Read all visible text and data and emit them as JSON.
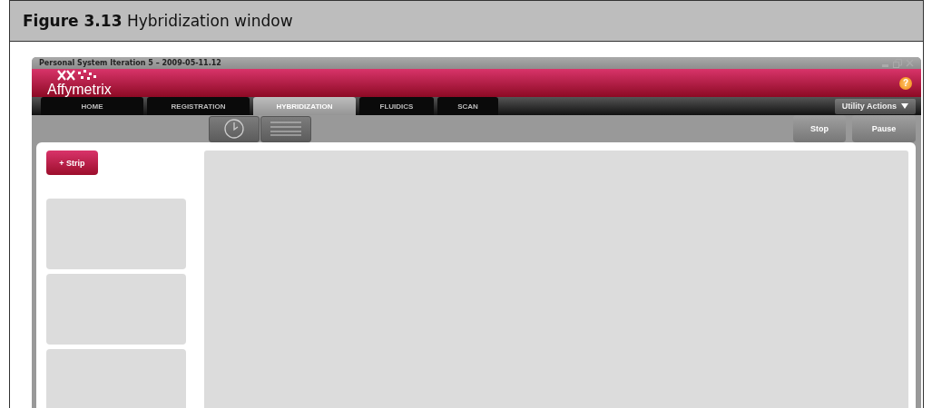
{
  "figure": {
    "caption": "**Figure 3.13**  Hybridization window"
  },
  "window": {
    "title": "Personal System Iteration 5 – 2009-05-11.12"
  },
  "header": {
    "logo": "Affymetrix",
    "help": "?"
  },
  "tabs": [
    {
      "label": "HOME",
      "selected": false
    },
    {
      "label": "REGISTRATION",
      "selected": false
    },
    {
      "label": "HYBRIDIZATION",
      "selected": true
    },
    {
      "label": "FLUIDICS",
      "selected": false
    },
    {
      "label": "SCAN",
      "selected": false
    }
  ],
  "utility_actions": {
    "label": "Utility Actions"
  },
  "buttons": [
    "Stop",
    "Pause"
  ],
  "strip_button": {
    "label": "+ Strip"
  }
}
